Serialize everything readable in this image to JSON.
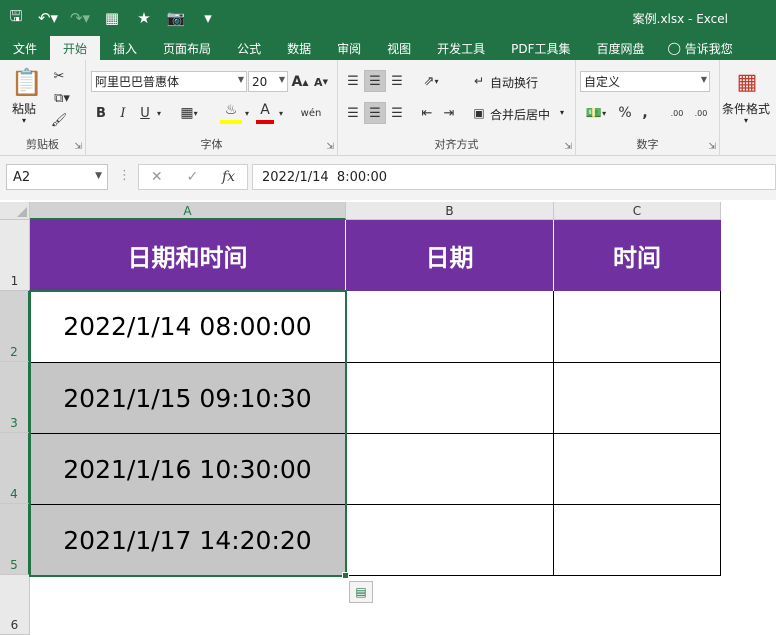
{
  "window": {
    "title": "案例.xlsx - Excel"
  },
  "qat": {
    "icons": [
      "save-icon",
      "undo-icon",
      "redo-icon",
      "form-icon",
      "star-icon",
      "camera-icon",
      "customize-icon"
    ]
  },
  "tabs": [
    {
      "label": "文件"
    },
    {
      "label": "开始"
    },
    {
      "label": "插入"
    },
    {
      "label": "页面布局"
    },
    {
      "label": "公式"
    },
    {
      "label": "数据"
    },
    {
      "label": "审阅"
    },
    {
      "label": "视图"
    },
    {
      "label": "开发工具"
    },
    {
      "label": "PDF工具集"
    },
    {
      "label": "百度网盘"
    },
    {
      "label": "告诉我您"
    }
  ],
  "ribbon": {
    "clipboard": {
      "label": "剪贴板",
      "paste": "粘贴"
    },
    "font": {
      "label": "字体",
      "name": "阿里巴巴普惠体",
      "size": "20",
      "grow": "A",
      "shrink": "A",
      "bold": "B",
      "italic": "I",
      "underline": "U",
      "fontcolor": "A",
      "phonetic": "wén"
    },
    "alignment": {
      "label": "对齐方式",
      "wrap": "自动换行",
      "merge": "合并后居中"
    },
    "number": {
      "label": "数字",
      "format": "自定义",
      "percent": "%",
      "comma": ",",
      "inc": ".00",
      "dec": ".00"
    },
    "styles": {
      "cond": "条件格式"
    }
  },
  "formula_bar": {
    "name_box": "A2",
    "fx": "fx",
    "value": "2022/1/14  8:00:00"
  },
  "columns": [
    "A",
    "B",
    "C"
  ],
  "rows": [
    "1",
    "2",
    "3",
    "4",
    "5",
    "6"
  ],
  "headers": [
    "日期和时间",
    "日期",
    "时间"
  ],
  "data": [
    "2022/1/14  08:00:00",
    "2021/1/15  09:10:30",
    "2021/1/16  10:30:00",
    "2021/1/17  14:20:20"
  ],
  "colors": {
    "excel_green": "#217346",
    "header_purple": "#7030a0",
    "selection_gray": "#c6c6c6"
  }
}
